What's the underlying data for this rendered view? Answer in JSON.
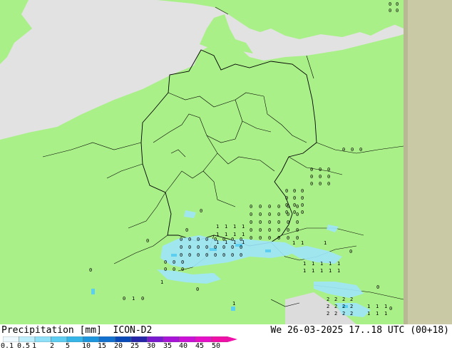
{
  "title": {
    "variable": "Precipitation [mm]",
    "model": "ICON-D2",
    "valid_time": "We 26-03-2025 17..18 UTC (00+18)"
  },
  "legend": {
    "ticks": [
      "0.1",
      "0.5",
      "1",
      "2",
      "5",
      "10",
      "15",
      "20",
      "25",
      "30",
      "35",
      "40",
      "45",
      "50"
    ],
    "colors": [
      "#eef9ff",
      "#bdeefc",
      "#8de0f8",
      "#5dcef2",
      "#36b6e8",
      "#1e96dd",
      "#1270cf",
      "#0a4ab8",
      "#2626a8",
      "#7a1ad0",
      "#a814d8",
      "#cc10d8",
      "#e610c8",
      "#f010a8"
    ]
  },
  "colors": {
    "land": "#aaf088",
    "sea": "#e2e2e2",
    "outside_domain": "#c9c9a6",
    "border": "#000000",
    "precip_light": "#9fe6fb",
    "precip_mid": "#5ccff0"
  },
  "markers": {
    "zero": "0",
    "one": "1",
    "two": "2"
  }
}
